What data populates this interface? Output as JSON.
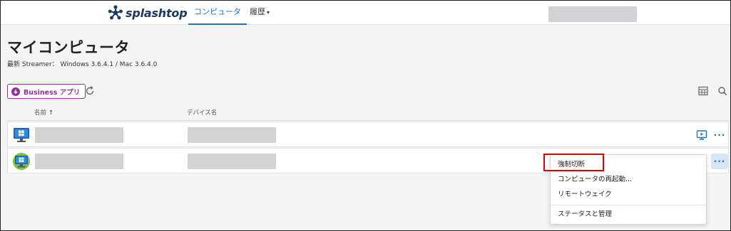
{
  "nav": {
    "logo_text": "splashtop",
    "tab_computers": "コンピュータ",
    "tab_history": "履歴",
    "history_caret": "▾"
  },
  "page": {
    "title": "マイコンピュータ",
    "streamer": "最新 Streamer： Windows 3.6.4.1 / Mac 3.6.4.0"
  },
  "toolbar": {
    "business_label": "Business アプリ"
  },
  "table": {
    "col_name": "名前",
    "col_name_sort": "↑",
    "col_device": "デバイス名",
    "more_label": "···"
  },
  "menu": {
    "items": [
      "強制切断",
      "コンピュータの再起動...",
      "リモートウェイク",
      "ステータスと管理"
    ]
  },
  "colors": {
    "accent": "#1f73c7",
    "business": "#8a3596",
    "highlight": "#e00000"
  }
}
